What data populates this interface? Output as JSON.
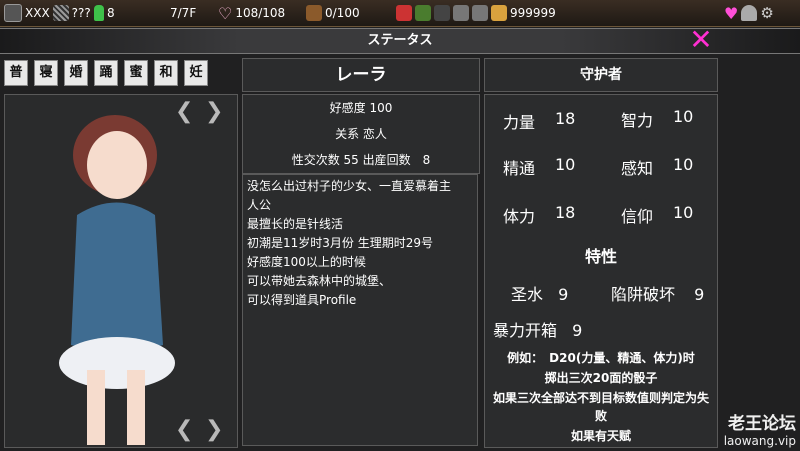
{
  "topbar": {
    "name": "XXX",
    "unknown": "???",
    "potion_count": "8",
    "floor": "7/7F",
    "hp": "108/108",
    "stamina": "0/100",
    "gold": "999999"
  },
  "title": "ステータス",
  "tabs": [
    "普",
    "寝",
    "婚",
    "踊",
    "蜜",
    "和",
    "妊"
  ],
  "character": {
    "name": "レーラ",
    "affection": "好感度 100",
    "relation": "关系 恋人",
    "counts": "性交次数 55 出産回数　8",
    "desc": [
      "没怎么出过村子的少女、一直爱慕着主",
      "人公",
      "最擅长的是针线活",
      "初潮是11岁时3月份 生理期时29号",
      "好感度100以上的时候",
      "可以带她去森林中的城堡、",
      "可以得到道具Profile"
    ]
  },
  "job": "守护者",
  "stats": [
    {
      "label": "力量",
      "value": "18"
    },
    {
      "label": "智力",
      "value": "10"
    },
    {
      "label": "精通",
      "value": "10"
    },
    {
      "label": "感知",
      "value": "10"
    },
    {
      "label": "体力",
      "value": "18"
    },
    {
      "label": "信仰",
      "value": "10"
    }
  ],
  "traits_title": "特性",
  "traits": [
    {
      "label": "圣水",
      "value": "9"
    },
    {
      "label": "陷阱破坏",
      "value": "9"
    },
    {
      "label": "暴力开箱",
      "value": "9"
    }
  ],
  "example": [
    "例如：　D20(力量、精通、体力)时",
    "掷出三次20面的骰子",
    "如果三次全部达不到目标数值则判定为失",
    "败",
    "如果有天赋"
  ],
  "watermark": {
    "title": "老王论坛",
    "url": "laowang.vip"
  }
}
